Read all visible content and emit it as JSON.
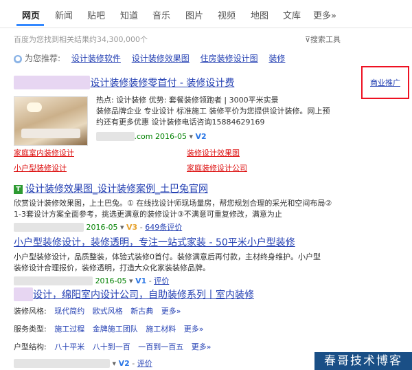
{
  "tabs": [
    "网页",
    "新闻",
    "贴吧",
    "知道",
    "音乐",
    "图片",
    "视频",
    "地图",
    "文库",
    "更多»"
  ],
  "result_count": "百度为您找到相关结果约34,300,000个",
  "search_tools": "搜索工具",
  "recommend": {
    "label": "为您推荐:",
    "links": [
      "设计装修软件",
      "设计装修效果图",
      "住房装修设计图",
      "装修"
    ]
  },
  "ad_label": "商业推广",
  "r1": {
    "title_suffix": "设计装修装修零首付 - 装修设计费",
    "line1": "热点: 设计装修    优势: 套餐装修领跑者 | 3000平米实景",
    "line2": "装修品牌企业 专业设计 标准施工 装修平价为您提供设计装修。网上预",
    "line3": "约还有更多优惠 设计装修电话咨询15884629169",
    "url_tail": ".com  2016-05",
    "verify": "V2",
    "sub_links": [
      "家庭室内装修设计",
      "装修设计效果图",
      "小户型装修设计",
      "家庭装修设计公司"
    ]
  },
  "r2": {
    "title": "设计装修效果图_设计装修案例_土巴兔官网",
    "line1": "欣赏设计装修效果图，上土巴兔。① 在线找设计师现场量房，帮您规划合理的采光和空间布局②",
    "line2": "1-3套设计方案全面参考，挑选更满意的装修设计③不满意可重复修改，满意为止",
    "url_tail": "2016-05",
    "verify": "V3",
    "reviews": "649条评价"
  },
  "r3": {
    "title": "小户型装修设计，装修透明，专注一站式家装 - 50平米小户型装修",
    "line1": "小户型装修设计，品质整装，体验式装修0首付。装修满意后再付款，主材终身维护。小户型",
    "line2": "装修设计合理报价，装修透明，打造大众化家装装修品牌。",
    "url_tail": "2016-05",
    "verify": "V1",
    "reviews": "评价"
  },
  "r4": {
    "title": "设计，绵阳室内设计公司，自助装修系列丨室内装修",
    "style_label": "装修风格:",
    "style_links": [
      "现代简约",
      "欧式风格",
      "新古典",
      "更多»"
    ],
    "service_label": "服务类型:",
    "service_links": [
      "施工过程",
      "金牌施工团队",
      "施工材料",
      "更多»"
    ],
    "layout_label": "户型结构:",
    "layout_links": [
      "八十平米",
      "八十到一百",
      "一百到一百五",
      "更多»"
    ],
    "verify": "V2",
    "reviews": "评价"
  },
  "watermark": "春哥技术博客"
}
